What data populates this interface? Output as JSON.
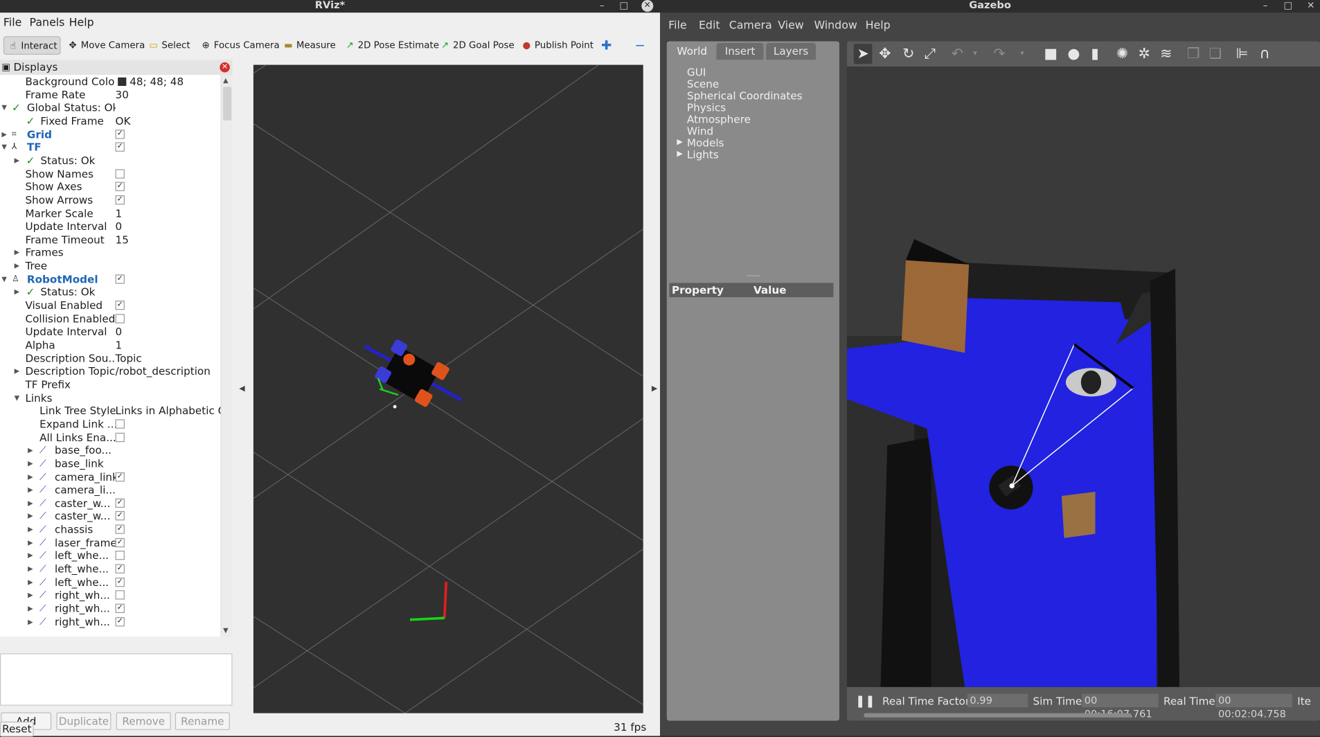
{
  "rviz": {
    "title": "RViz*",
    "menu": [
      "File",
      "Panels",
      "Help"
    ],
    "tools": {
      "interact": "Interact",
      "move_camera": "Move Camera",
      "select": "Select",
      "focus_camera": "Focus Camera",
      "measure": "Measure",
      "pose_estimate": "2D Pose Estimate",
      "goal_pose": "2D Goal Pose",
      "publish_point": "Publish Point"
    },
    "displays_title": "Displays",
    "rows": {
      "bg_color": {
        "name": "Background Color",
        "value": "48; 48; 48"
      },
      "frame_rate": {
        "name": "Frame Rate",
        "value": "30"
      },
      "global_status": {
        "name": "Global Status: Ok"
      },
      "fixed_frame": {
        "name": "Fixed Frame",
        "value": "OK"
      },
      "grid": {
        "name": "Grid"
      },
      "tf": {
        "name": "TF"
      },
      "tf_status": {
        "name": "Status: Ok"
      },
      "show_names": {
        "name": "Show Names"
      },
      "show_axes": {
        "name": "Show Axes"
      },
      "show_arrows": {
        "name": "Show Arrows"
      },
      "marker_scale": {
        "name": "Marker Scale",
        "value": "1"
      },
      "update_interval": {
        "name": "Update Interval",
        "value": "0"
      },
      "frame_timeout": {
        "name": "Frame Timeout",
        "value": "15"
      },
      "frames": {
        "name": "Frames"
      },
      "tree": {
        "name": "Tree"
      },
      "robot_model": {
        "name": "RobotModel"
      },
      "rm_status": {
        "name": "Status: Ok"
      },
      "visual_enabled": {
        "name": "Visual Enabled"
      },
      "collision_enabled": {
        "name": "Collision Enabled"
      },
      "rm_update_interval": {
        "name": "Update Interval",
        "value": "0"
      },
      "alpha": {
        "name": "Alpha",
        "value": "1"
      },
      "desc_source": {
        "name": "Description Sou...",
        "value": "Topic"
      },
      "desc_topic": {
        "name": "Description Topic",
        "value": "/robot_description"
      },
      "tf_prefix": {
        "name": "TF Prefix"
      },
      "links": {
        "name": "Links"
      },
      "link_tree_style": {
        "name": "Link Tree Style",
        "value": "Links in Alphabetic Or..."
      },
      "expand_link": {
        "name": "Expand Link ..."
      },
      "all_links": {
        "name": "All Links Ena..."
      }
    },
    "links": [
      "base_foo...",
      "base_link",
      "camera_link",
      "camera_li...",
      "caster_w...",
      "caster_w...",
      "chassis",
      "laser_frame",
      "left_whe...",
      "left_whe...",
      "left_whe...",
      "right_wh...",
      "right_wh...",
      "right_wh..."
    ],
    "buttons": {
      "add": "Add",
      "duplicate": "Duplicate",
      "remove": "Remove",
      "rename": "Rename",
      "reset": "Reset"
    },
    "fps": "31 fps"
  },
  "gazebo": {
    "title": "Gazebo",
    "menu": [
      "File",
      "Edit",
      "Camera",
      "View",
      "Window",
      "Help"
    ],
    "tabs": [
      "World",
      "Insert",
      "Layers"
    ],
    "world_items": [
      "GUI",
      "Scene",
      "Spherical Coordinates",
      "Physics",
      "Atmosphere",
      "Wind",
      "Models",
      "Lights"
    ],
    "property_header": "Property",
    "value_header": "Value",
    "status": {
      "rtf_label": "Real Time Factor:",
      "rtf_value": "0.99",
      "sim_label": "Sim Time:",
      "sim_value": "00 00:16:07.761",
      "real_label": "Real Time:",
      "real_value": "00 00:02:04.758",
      "iter_label": "Ite"
    }
  },
  "colors": {
    "rviz_bg": "#303030",
    "laser_blue": "#1f1fe6",
    "accent_blue": "#1f66b3"
  }
}
